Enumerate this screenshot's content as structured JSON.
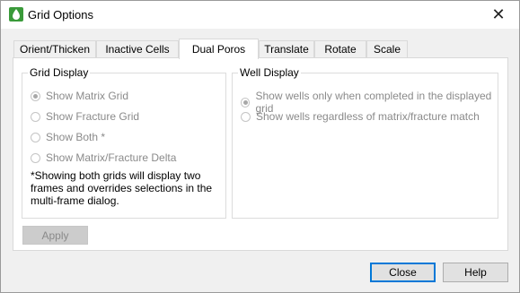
{
  "window": {
    "title": "Grid Options",
    "close_glyph": "✕"
  },
  "tabs": [
    {
      "label": "Orient/Thicken"
    },
    {
      "label": "Inactive Cells"
    },
    {
      "label": "Dual Poros"
    },
    {
      "label": "Translate"
    },
    {
      "label": "Rotate"
    },
    {
      "label": "Scale"
    }
  ],
  "grid_display": {
    "title": "Grid Display",
    "options": [
      {
        "label": "Show Matrix Grid",
        "checked": true
      },
      {
        "label": "Show Fracture Grid",
        "checked": false
      },
      {
        "label": "Show Both *",
        "checked": false
      },
      {
        "label": "Show Matrix/Fracture Delta",
        "checked": false
      }
    ],
    "note": "*Showing both grids will display two frames and overrides selections in the multi-frame dialog."
  },
  "well_display": {
    "title": "Well Display",
    "options": [
      {
        "label": "Show wells only when completed in the displayed grid",
        "checked": true
      },
      {
        "label": "Show wells regardless of matrix/fracture match",
        "checked": false
      }
    ]
  },
  "buttons": {
    "apply": "Apply",
    "close": "Close",
    "help": "Help"
  },
  "icons": {
    "app": "drop-icon",
    "close": "close-icon"
  },
  "colors": {
    "app_icon": "#3a9a3a",
    "default_border": "#0078d7"
  }
}
